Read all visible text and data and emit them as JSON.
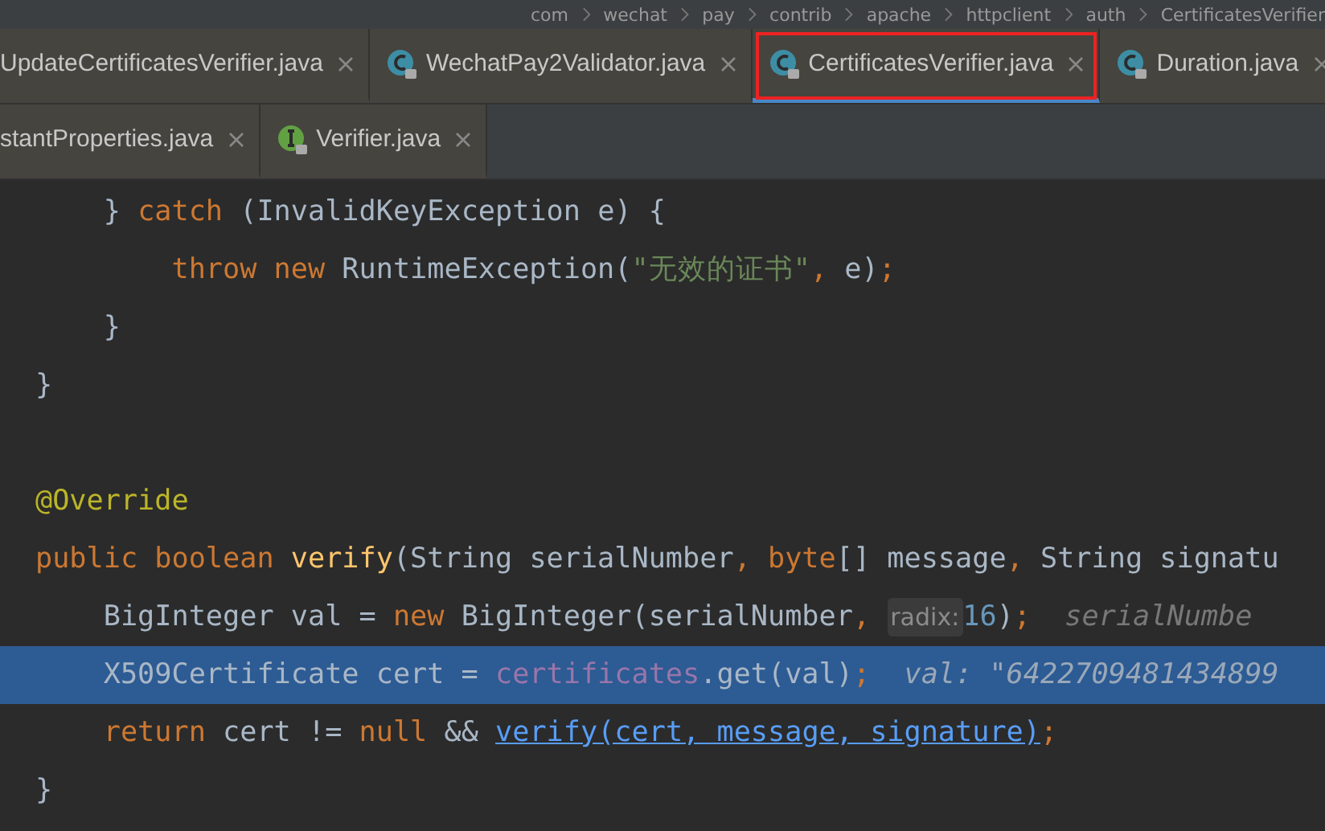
{
  "breadcrumb": [
    "com",
    "wechat",
    "pay",
    "contrib",
    "apache",
    "httpclient",
    "auth",
    "CertificatesVerifier"
  ],
  "tab_rows": [
    [
      {
        "label": "UpdateCertificatesVerifier.java",
        "kind": "plain",
        "selected": false,
        "outlined": false
      },
      {
        "label": "WechatPay2Validator.java",
        "kind": "class",
        "selected": false,
        "outlined": false
      },
      {
        "label": "CertificatesVerifier.java",
        "kind": "class",
        "selected": true,
        "outlined": true
      },
      {
        "label": "Duration.java",
        "kind": "class",
        "selected": false,
        "outlined": false
      }
    ],
    [
      {
        "label": "stantProperties.java",
        "kind": "plain",
        "selected": false,
        "outlined": false
      },
      {
        "label": "Verifier.java",
        "kind": "interface",
        "selected": false,
        "outlined": false
      }
    ]
  ],
  "code_lines": [
    {
      "highlighted": false,
      "tokens": [
        {
          "kind": "plain",
          "text": "    } "
        },
        {
          "kind": "kw",
          "text": "catch"
        },
        {
          "kind": "plain",
          "text": " (InvalidKeyException e) {"
        }
      ]
    },
    {
      "highlighted": false,
      "tokens": [
        {
          "kind": "kw",
          "text": "        throw new"
        },
        {
          "kind": "plain",
          "text": " RuntimeException("
        },
        {
          "kind": "str",
          "text": "\"无效的证书\""
        },
        {
          "kind": "kw",
          "text": ","
        },
        {
          "kind": "plain",
          "text": " e)"
        },
        {
          "kind": "kw",
          "text": ";"
        }
      ]
    },
    {
      "highlighted": false,
      "tokens": [
        {
          "kind": "plain",
          "text": "    }"
        }
      ]
    },
    {
      "highlighted": false,
      "tokens": [
        {
          "kind": "plain",
          "text": "}"
        }
      ]
    },
    {
      "highlighted": false
    },
    {
      "highlighted": false,
      "tokens": [
        {
          "kind": "annot",
          "text": "@Override"
        }
      ]
    },
    {
      "highlighted": false,
      "tokens": [
        {
          "kind": "kw",
          "text": "public boolean "
        },
        {
          "kind": "fn",
          "text": "verify"
        },
        {
          "kind": "plain",
          "text": "(String serialNumber"
        },
        {
          "kind": "kw",
          "text": ", byte"
        },
        {
          "kind": "plain",
          "text": "[] message"
        },
        {
          "kind": "kw",
          "text": ","
        },
        {
          "kind": "plain",
          "text": " String signatu"
        }
      ]
    },
    {
      "highlighted": false,
      "tokens": [
        {
          "kind": "plain",
          "text": "    BigInteger val = "
        },
        {
          "kind": "kw",
          "text": "new"
        },
        {
          "kind": "plain",
          "text": " BigInteger(serialNumber"
        },
        {
          "kind": "kw",
          "text": ", "
        },
        {
          "kind": "hint",
          "text": "radix:"
        },
        {
          "kind": "num",
          "text": "16"
        },
        {
          "kind": "plain",
          "text": ")"
        },
        {
          "kind": "kw",
          "text": ";"
        },
        {
          "kind": "debug",
          "text": "  serialNumbe"
        }
      ]
    },
    {
      "highlighted": true,
      "tokens": [
        {
          "kind": "plain",
          "text": "    X509Certificate cert = "
        },
        {
          "kind": "field",
          "text": "certificates"
        },
        {
          "kind": "plain",
          "text": ".get(val)"
        },
        {
          "kind": "kw",
          "text": ";"
        },
        {
          "kind": "debug",
          "text": "  val: \"6422709481434899"
        }
      ]
    },
    {
      "highlighted": false,
      "tokens": [
        {
          "kind": "kw",
          "text": "    return"
        },
        {
          "kind": "plain",
          "text": " cert != "
        },
        {
          "kind": "kw",
          "text": "null"
        },
        {
          "kind": "plain",
          "text": " && "
        },
        {
          "kind": "link",
          "text": "verify(cert, message, signature)"
        },
        {
          "kind": "kw",
          "text": ";"
        }
      ]
    },
    {
      "highlighted": false,
      "tokens": [
        {
          "kind": "plain",
          "text": "}"
        }
      ]
    }
  ]
}
